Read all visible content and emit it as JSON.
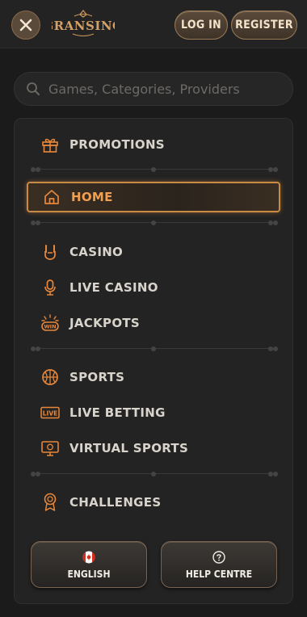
{
  "header": {
    "logo_text": "GRANSINO",
    "login_label": "LOG IN",
    "register_label": "REGISTER"
  },
  "search": {
    "placeholder": "Games, Categories, Providers"
  },
  "menu": {
    "promotions": "PROMOTIONS",
    "home": "HOME",
    "casino": "CASINO",
    "live_casino": "LIVE CASINO",
    "jackpots": "JACKPOTS",
    "sports": "SPORTS",
    "live_betting": "LIVE BETTING",
    "virtual_sports": "VIRTUAL SPORTS",
    "challenges": "CHALLENGES"
  },
  "icons": {
    "promotions": "gift-icon",
    "home": "home-icon",
    "casino": "rock-hand-icon",
    "live_casino": "microphone-icon",
    "jackpots": "jackpot-win-icon",
    "sports": "basketball-icon",
    "live_betting": "live-badge-icon",
    "virtual_sports": "virtual-monitor-icon",
    "challenges": "medal-icon",
    "live_badge_text": "LIVE",
    "win_badge_text": "WIN"
  },
  "footer": {
    "language_label": "ENGLISH",
    "help_label": "HELP CENTRE"
  },
  "colors": {
    "accent": "#e8873a",
    "active_text": "#f2a050",
    "background": "#1b1b1b",
    "panel": "#232323"
  }
}
